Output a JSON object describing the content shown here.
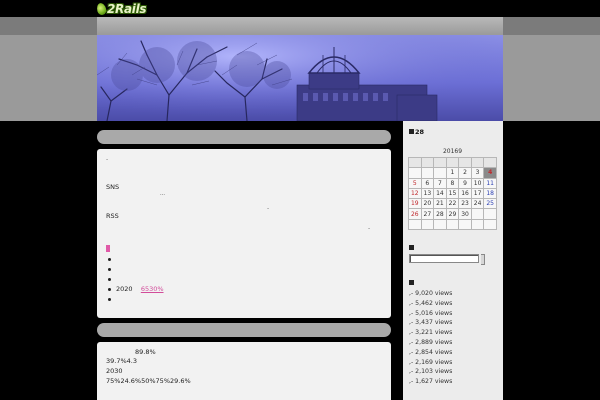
{
  "header": {
    "logo_text": "2Rails"
  },
  "main": {
    "post1": {
      "lines": [
        ".",
        "SNS",
        "…",
        ".",
        "RSS",
        "."
      ],
      "list_items": [
        "",
        "",
        "",
        "2020",
        ""
      ],
      "link_text": "6530%"
    },
    "post2": {
      "lines": [
        "89.8%",
        "39.7%4.3",
        "2030",
        "75%24.6%50%75%29.6%"
      ]
    }
  },
  "sidebar": {
    "calendar": {
      "title": "28",
      "caption": "20169",
      "weeks": [
        [
          "",
          "",
          "",
          "",
          "",
          "",
          ""
        ],
        [
          "",
          "",
          "",
          "1",
          "2",
          "3",
          "4"
        ],
        [
          "5",
          "6",
          "7",
          "8",
          "9",
          "10",
          "11"
        ],
        [
          "12",
          "13",
          "14",
          "15",
          "16",
          "17",
          "18"
        ],
        [
          "19",
          "20",
          "21",
          "22",
          "23",
          "24",
          "25"
        ],
        [
          "26",
          "27",
          "28",
          "29",
          "30",
          "",
          ""
        ],
        [
          "",
          "",
          "",
          "",
          "",
          "",
          ""
        ]
      ],
      "today": "4"
    },
    "search": {
      "title": "",
      "value": ""
    },
    "popular": {
      "title": "",
      "items": [
        ",- 9,020 views",
        ",- 5,462 views",
        ",- 5,016 views",
        ",- 3,437 views",
        ",- 3,221 views",
        ",- 2,889 views",
        ",- 2,854 views",
        ",- 2,169 views",
        ",- 2,103 views",
        ",- 1,627 views"
      ]
    }
  },
  "colors": {
    "accent_pink": "#e05aa8",
    "banner_sky": "#8c90e6",
    "sunday_red": "#c0282c",
    "saturday_blue": "#2c3fb3"
  }
}
